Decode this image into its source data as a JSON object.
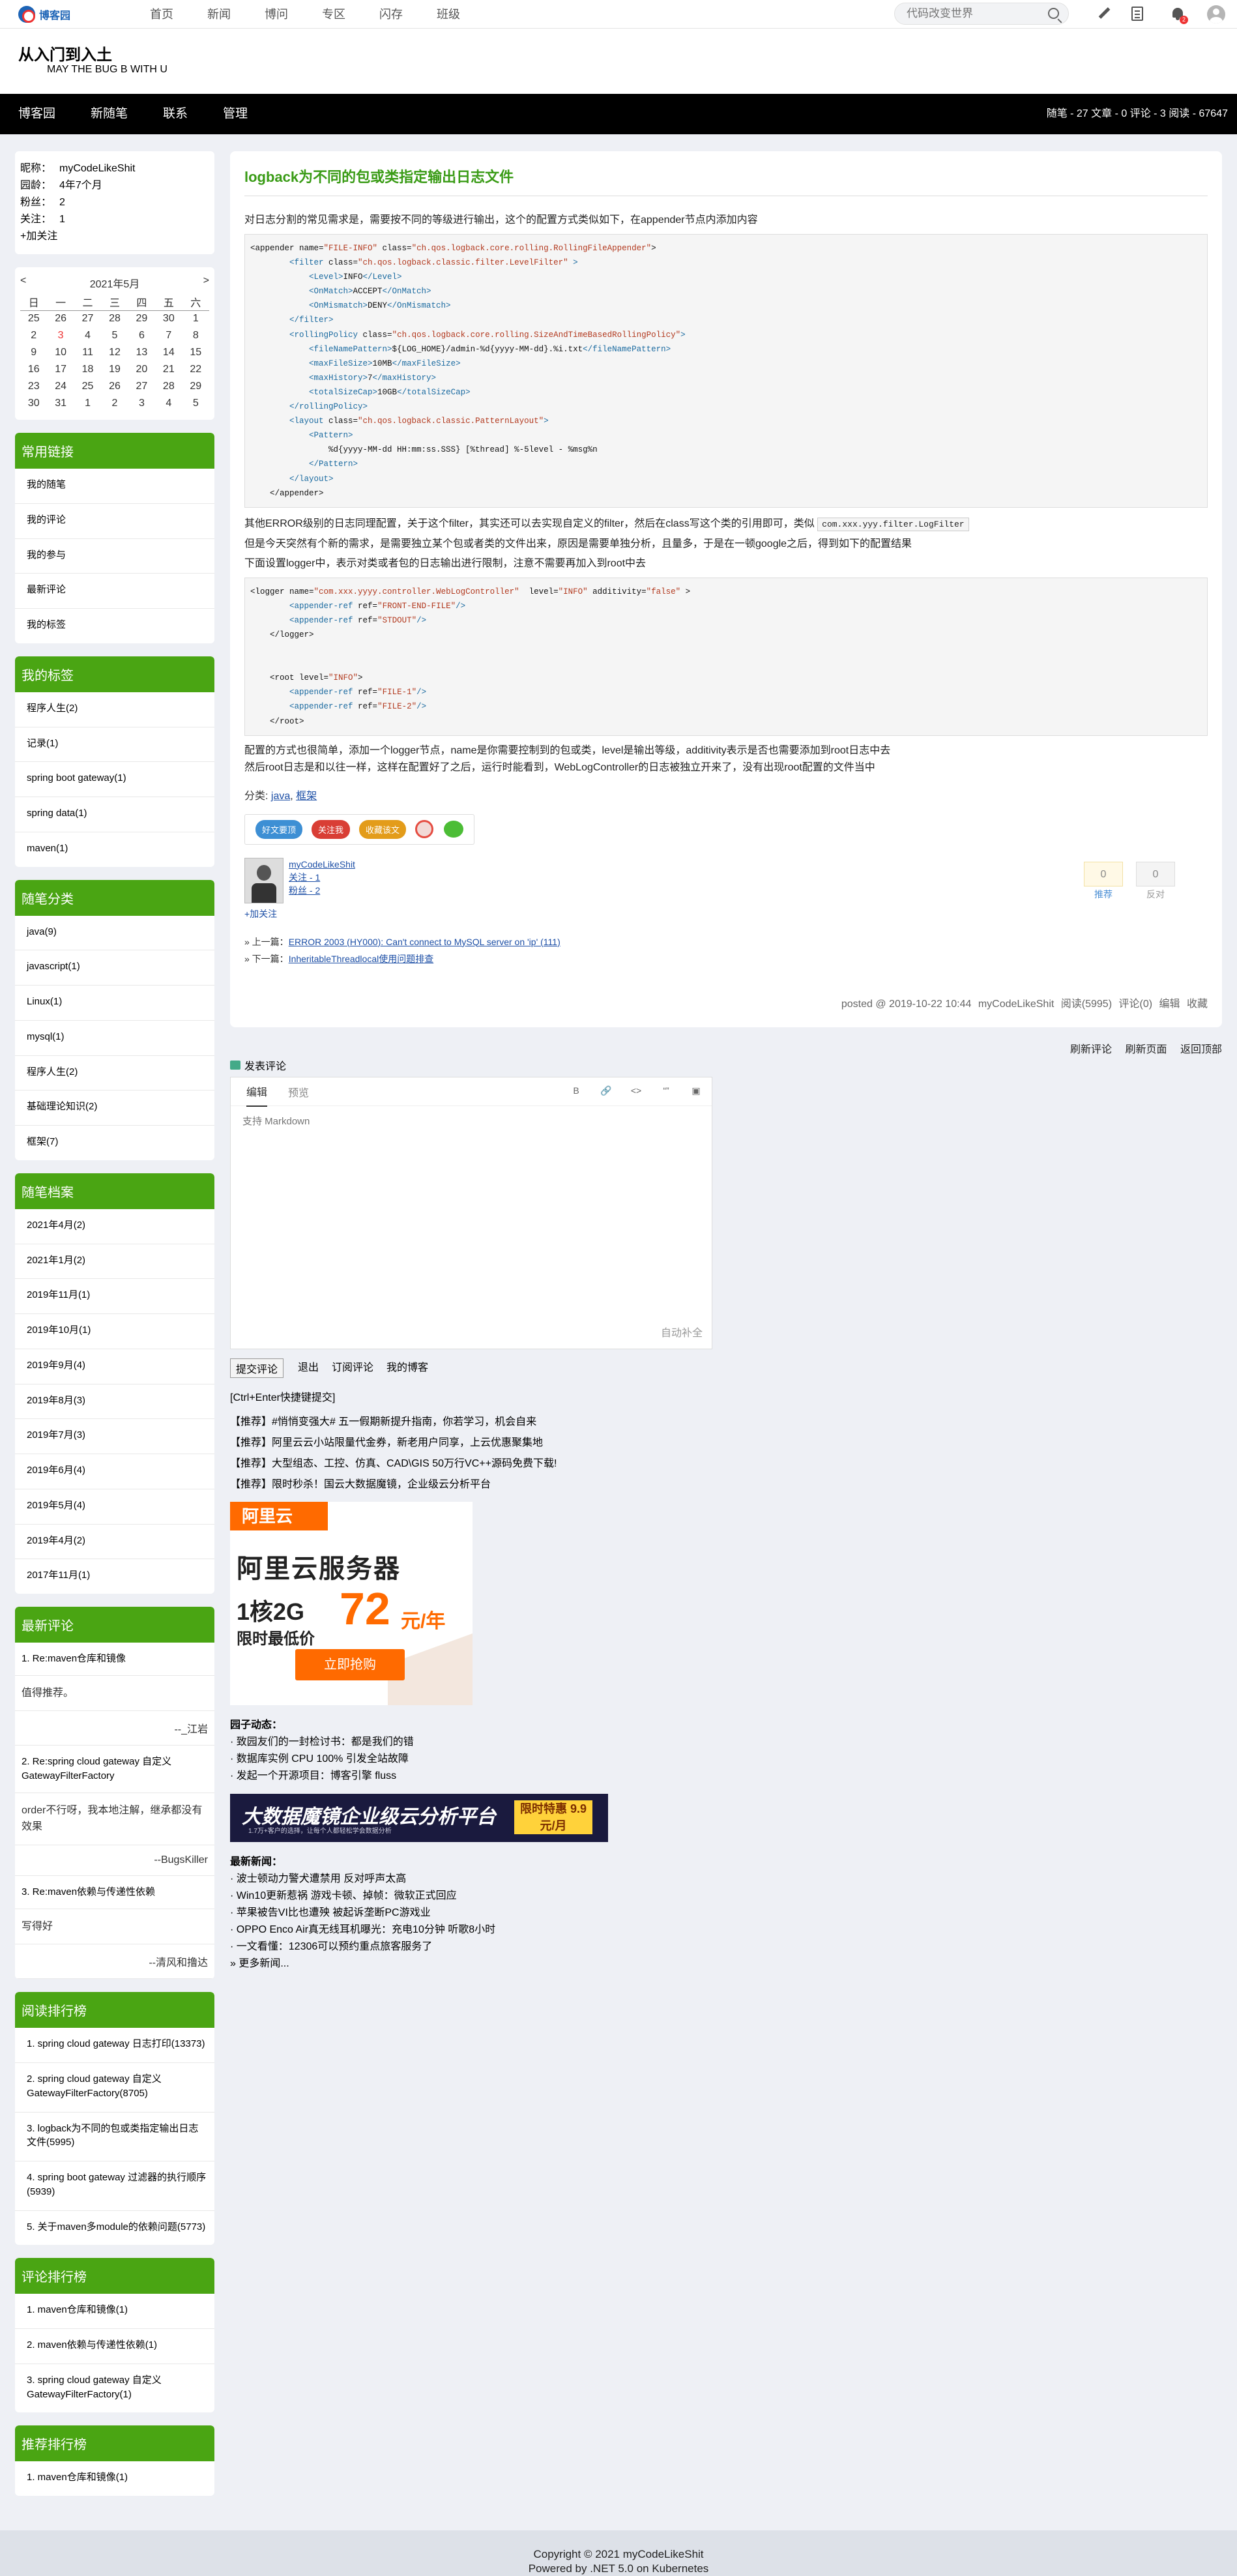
{
  "topnav": {
    "brand": "博客园",
    "menu": [
      "首页",
      "新闻",
      "博问",
      "专区",
      "闪存",
      "班级"
    ],
    "search_placeholder": "代码改变世界"
  },
  "header": {
    "title": "从入门到入土",
    "subtitle": "MAY THE BUG B WITH U"
  },
  "mainnav": {
    "items": [
      "博客园",
      "新随笔",
      "联系",
      "管理"
    ],
    "stats": "随笔 - 27  文章 - 0  评论 - 3  阅读 - 67647"
  },
  "profile": {
    "rows": [
      {
        "k": "昵称：",
        "v": "myCodeLikeShit"
      },
      {
        "k": "园龄：",
        "v": "4年7个月"
      },
      {
        "k": "粉丝：",
        "v": "2"
      },
      {
        "k": "关注：",
        "v": "1"
      }
    ],
    "follow": "+加关注"
  },
  "calendar": {
    "prev": "<",
    "title": "2021年5月",
    "next": ">",
    "weekdays": [
      "日",
      "一",
      "二",
      "三",
      "四",
      "五",
      "六"
    ],
    "rows": [
      [
        "25",
        "26",
        "27",
        "28",
        "29",
        "30",
        "1"
      ],
      [
        "2",
        "3",
        "4",
        "5",
        "6",
        "7",
        "8"
      ],
      [
        "9",
        "10",
        "11",
        "12",
        "13",
        "14",
        "15"
      ],
      [
        "16",
        "17",
        "18",
        "19",
        "20",
        "21",
        "22"
      ],
      [
        "23",
        "24",
        "25",
        "26",
        "27",
        "28",
        "29"
      ],
      [
        "30",
        "31",
        "1",
        "2",
        "3",
        "4",
        "5"
      ]
    ]
  },
  "links": {
    "title": "常用链接",
    "items": [
      "我的随笔",
      "我的评论",
      "我的参与",
      "最新评论",
      "我的标签"
    ]
  },
  "tags": {
    "title": "我的标签",
    "items": [
      "程序人生(2)",
      "记录(1)",
      "spring boot gateway(1)",
      "spring data(1)",
      "maven(1)"
    ]
  },
  "categories": {
    "title": "随笔分类",
    "items": [
      "java(9)",
      "javascript(1)",
      "Linux(1)",
      "mysql(1)",
      "程序人生(2)",
      "基础理论知识(2)",
      "框架(7)"
    ]
  },
  "archives": {
    "title": "随笔档案",
    "items": [
      "2021年4月(2)",
      "2021年1月(2)",
      "2019年11月(1)",
      "2019年10月(1)",
      "2019年9月(4)",
      "2019年8月(3)",
      "2019年7月(3)",
      "2019年6月(4)",
      "2019年5月(4)",
      "2019年4月(2)",
      "2017年11月(1)"
    ]
  },
  "recent_comments": {
    "title": "最新评论",
    "items": [
      {
        "title": "1. Re:maven仓库和镜像",
        "quote": "值得推荐。",
        "by": "--_江岩"
      },
      {
        "title": "2. Re:spring cloud gateway 自定义GatewayFilterFactory",
        "quote": "order不行呀，我本地注解，继承都没有效果",
        "by": "--BugsKiller"
      },
      {
        "title": "3. Re:maven依赖与传递性依赖",
        "quote": "写得好",
        "by": "--清风和撸达"
      }
    ]
  },
  "read_rank": {
    "title": "阅读排行榜",
    "items": [
      "1. spring cloud gateway 日志打印(13373)",
      "2. spring cloud gateway 自定义GatewayFilterFactory(8705)",
      "3. logback为不同的包或类指定输出日志文件(5995)",
      "4. spring boot gateway 过滤器的执行顺序(5939)",
      "5. 关于maven多module的依赖问题(5773)"
    ]
  },
  "comment_rank": {
    "title": "评论排行榜",
    "items": [
      "1. maven仓库和镜像(1)",
      "2. maven依赖与传递性依赖(1)",
      "3. spring cloud gateway 自定义GatewayFilterFactory(1)"
    ]
  },
  "recommend_rank": {
    "title": "推荐排行榜",
    "items": [
      "1. maven仓库和镜像(1)"
    ]
  },
  "post": {
    "title": "logback为不同的包或类指定输出日志文件",
    "p1": "对日志分割的常见需求是，需要按不同的等级进行输出，这个的配置方式类似如下，在appender节点内添加内容",
    "p2a": "其他ERROR级别的日志同理配置，关于这个filter，其实还可以去实现自定义的filter，然后在class写这个类的引用即可，类似",
    "p2code": "com.xxx.yyy.filter.LogFilter",
    "p3": "但是今天突然有个新的需求，是需要独立某个包或者类的文件出来，原因是需要单独分析，且量多，于是在一顿google之后，得到如下的配置结果",
    "p4": "下面设置logger中，表示对类或者包的日志输出进行限制，注意不需要再加入到root中去",
    "p5": "配置的方式也很简单，添加一个logger节点，name是你需要控制到的包或类，level是输出等级，additivity表示是否也需要添加到root日志中去",
    "p6": "然后root日志是和以往一样，这样在配置好了之后，运行时能看到，WebLogController的日志被独立开来了，没有出现root配置的文件当中",
    "category_label": "分类:",
    "cat1": "java",
    "cat2": "框架",
    "share": [
      "好文要顶",
      "关注我",
      "收藏该文"
    ],
    "author": {
      "name": "myCodeLikeShit",
      "follow": "关注 - 1",
      "fans": "粉丝 - 2",
      "plus": "+加关注"
    },
    "vote": {
      "up": "0",
      "up_label": "推荐",
      "down": "0",
      "down_label": "反对"
    },
    "prev_label": "» 上一篇：",
    "prev": "ERROR 2003 (HY000): Can't connect to MySQL server on 'ip' (111)",
    "next_label": "» 下一篇：",
    "next": "InheritableThreadlocal使用问题排查",
    "foot": {
      "posted": "posted @ 2019-10-22 10:44",
      "author": "myCodeLikeShit",
      "read": "阅读(5995)",
      "comments": "评论(0)",
      "edit": "编辑",
      "fav": "收藏"
    }
  },
  "subline": [
    "刷新评论",
    "刷新页面",
    "返回顶部"
  ],
  "comment_box": {
    "label": "发表评论",
    "tab_edit": "编辑",
    "tab_preview": "预览",
    "tools": [
      "B",
      "🔗",
      "<>",
      "“”",
      "▣"
    ],
    "placeholder": "支持 Markdown",
    "autocomplete": "自动补全",
    "submit": "提交评论",
    "logout": "退出",
    "subscribe": "订阅评论",
    "myblog": "我的博客",
    "hint": "[Ctrl+Enter快捷键提交]"
  },
  "ads": [
    "【推荐】#悄悄变强大# 五一假期新提升指南，你若学习，机会自来",
    "【推荐】阿里云云小站限量代金券，新老用户同享，上云优惠聚集地",
    "【推荐】大型组态、工控、仿真、CAD\\GIS 50万行VC++源码免费下载!",
    "【推荐】限时秒杀！国云大数据魔镜，企业级云分析平台"
  ],
  "banner1": {
    "brand": "阿里云",
    "headline": "阿里云服务器",
    "spec": "1核2G",
    "price": "72",
    "unit": "元/年",
    "low": "限时最低价",
    "buy": "立即抢购"
  },
  "news": {
    "garden_title": "园子动态：",
    "garden": [
      "· 致园友们的一封检讨书：都是我们的错",
      "· 数据库实例 CPU 100% 引发全站故障",
      "· 发起一个开源项目：博客引擎 fluss"
    ],
    "news_title": "最新新闻：",
    "items": [
      "· 波士顿动力警犬遭禁用 反对呼声太高",
      "· Win10更新惹祸 游戏卡顿、掉帧：微软正式回应",
      "· 苹果被告VI比也遭殃 被起诉垄断PC游戏业",
      "· OPPO Enco Air真无线耳机曝光：充电10分钟 听歌8小时",
      "· 一文看懂：12306可以预约重点旅客服务了"
    ],
    "more": "» 更多新闻..."
  },
  "banner2": {
    "title": "大数据魔镜企业级云分析平台",
    "tag": "限时特惠 9.9元/月",
    "sub": "1.7万+客户的选择，让每个人都轻松学会数据分析"
  },
  "footer": {
    "copyright": "Copyright © 2021 myCodeLikeShit",
    "powered": "Powered by .NET 5.0 on Kubernetes"
  },
  "colors": {
    "accent": "#4aa513",
    "title": "#399b15",
    "nav": "#000000"
  }
}
